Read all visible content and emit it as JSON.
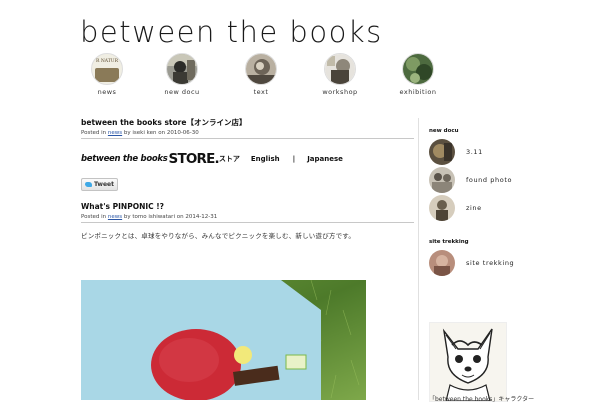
{
  "site": {
    "title": "between the books"
  },
  "nav": [
    {
      "label": "news",
      "thumb_text": "R NATUR"
    },
    {
      "label": "new docu"
    },
    {
      "label": "text"
    },
    {
      "label": "workshop"
    },
    {
      "label": "exhibition"
    }
  ],
  "posts": [
    {
      "title": "between the books store【オンライン店】",
      "meta_prefix": "Posted in",
      "category": "news",
      "meta_by": "by iseki ken on 2010-06-30",
      "store_logo_small": "between the books",
      "store_logo_big": "STORE.",
      "store_jp": "ストア",
      "lang_english": "English",
      "lang_sep": "|",
      "lang_japanese": "Japanese",
      "tweet_label": "Tweet"
    },
    {
      "title": "What's PINPONIC !?",
      "meta_prefix": "Posted in",
      "category": "news",
      "meta_by": "by tomo ishiwatari on 2014-12-31",
      "body": "ピンポニックとは、卓球をやりながら、みんなでピクニックを楽しむ、新しい遊び方です。"
    }
  ],
  "sidebar": {
    "new_docu_heading": "new docu",
    "new_docu_items": [
      {
        "label": "3.11"
      },
      {
        "label": "found photo"
      },
      {
        "label": "zine"
      }
    ],
    "site_trekking_heading": "site trekking",
    "site_trekking_items": [
      {
        "label": "site trekking"
      }
    ],
    "banner_caption": "「between the books」キャラクター"
  },
  "colors": {
    "link": "#2a56a6",
    "grass": "#5f8e33",
    "table": "#a9d7e6",
    "paddle": "#cc2a36"
  }
}
